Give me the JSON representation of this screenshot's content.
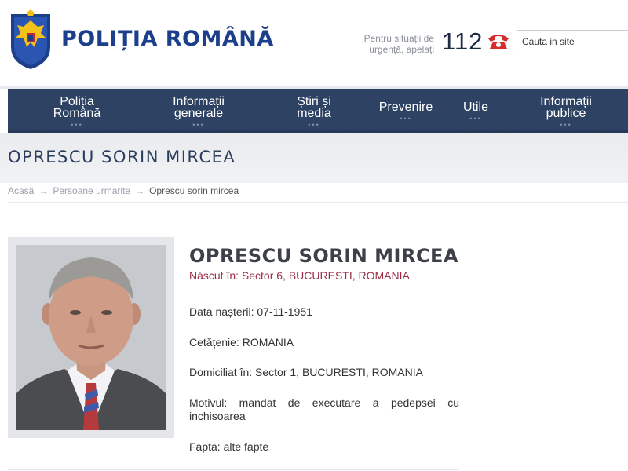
{
  "header": {
    "brand": "POLIȚIA ROMÂNĂ",
    "emergency_text": "Pentru situații de urgență, apelați",
    "emergency_number": "112",
    "search_placeholder": "Cauta in site"
  },
  "nav": {
    "items": [
      {
        "label": "Poliția\nRomână"
      },
      {
        "label": "Informații\ngenerale"
      },
      {
        "label": "Știri și\nmedia"
      },
      {
        "label": "Prevenire"
      },
      {
        "label": "Utile"
      },
      {
        "label": "Informații\npublice"
      }
    ],
    "dots": "•••"
  },
  "page": {
    "title": "OPRESCU SORIN MIRCEA"
  },
  "breadcrumb": {
    "items": [
      "Acasă",
      "Persoane urmarite",
      "Oprescu sorin mircea"
    ],
    "separator": "→"
  },
  "profile": {
    "name": "OPRESCU SORIN MIRCEA",
    "born": "Născut în: Sector 6, BUCURESTI, ROMANIA",
    "birth_date": "Data nașterii: 07-11-1951",
    "citizenship": "Cetățenie: ROMANIA",
    "residence": "Domiciliat în: Sector 1, BUCURESTI, ROMANIA",
    "reason": "Motivul: mandat de executare a pedepsei cu inchisoarea",
    "offense": "Fapta: alte fapte"
  },
  "colors": {
    "brand": "#1c3f8c",
    "nav_bg": "#2e4263",
    "born_text": "#9a2f44",
    "phone_icon": "#d62c2c"
  }
}
